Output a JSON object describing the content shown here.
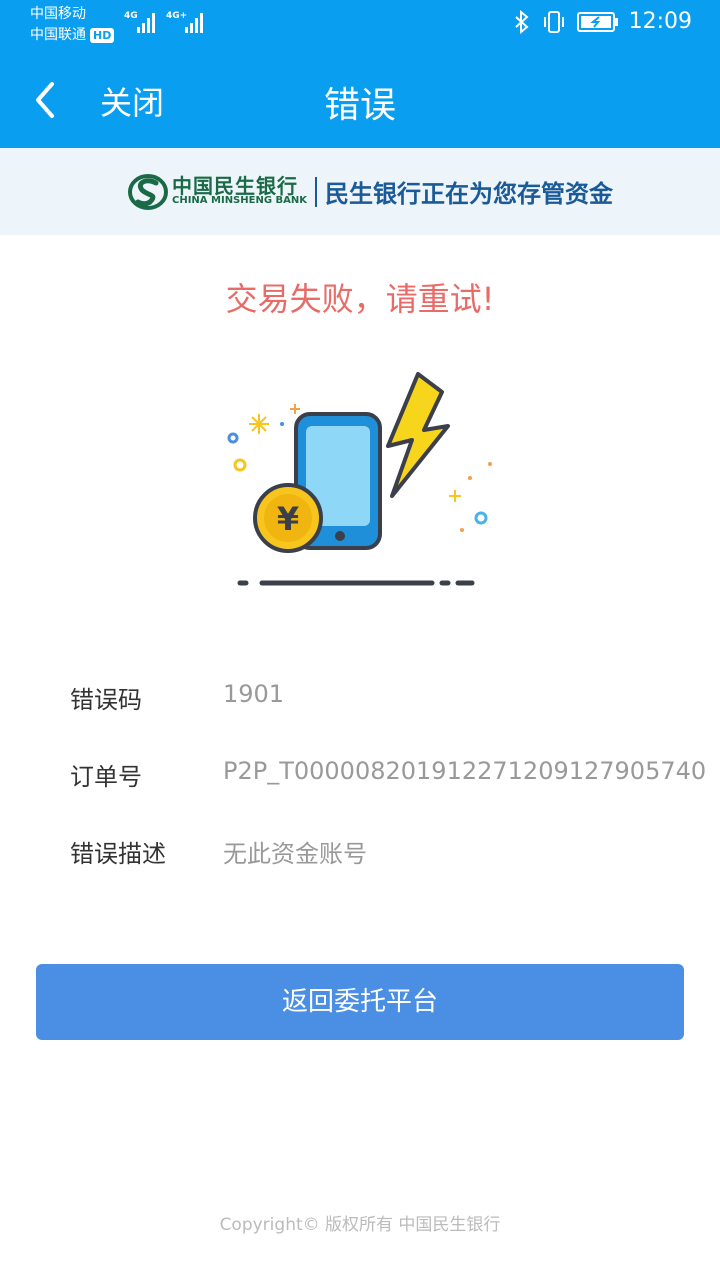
{
  "status_bar": {
    "carrier1": "中国移动",
    "carrier2": "中国联通",
    "hd_badge": "HD",
    "network1": "4G",
    "network2": "4G+",
    "time": "12:09"
  },
  "nav": {
    "close_label": "关闭",
    "title": "错误"
  },
  "banner": {
    "bank_name_cn": "中国民生银行",
    "bank_name_en": "CHINA MINSHENG BANK",
    "slogan": "民生银行正在为您存管资金"
  },
  "result": {
    "message": "交易失败，请重试!",
    "illustration": "phone-lightning-yuan-icon"
  },
  "details": [
    {
      "label": "错误码",
      "value": "1901"
    },
    {
      "label": "订单号",
      "value": "P2P_T00000820191227120912790574​0"
    },
    {
      "label": "错误描述",
      "value": "无此资金账号"
    }
  ],
  "action": {
    "return_label": "返回委托平台"
  },
  "footer": {
    "copyright": "Copyright© 版权所有 中国民生银行"
  },
  "colors": {
    "header": "#0a9ef0",
    "banner_bg": "#edf4fa",
    "error_text": "#e86b67",
    "button": "#4a8fe3"
  }
}
